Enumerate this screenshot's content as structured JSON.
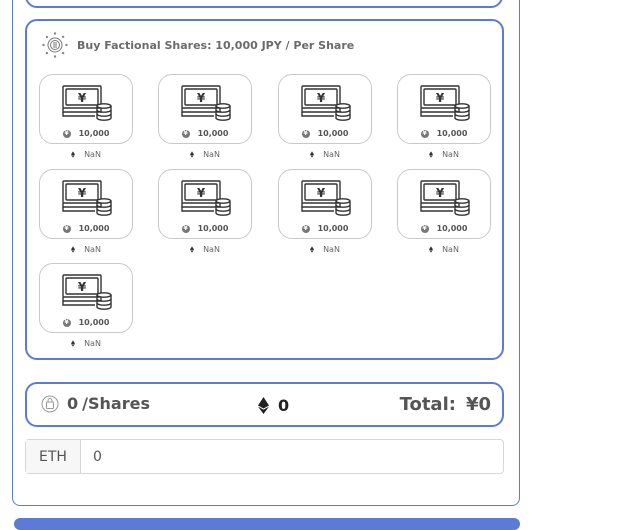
{
  "panel": {
    "title": "Buy Factional Shares: 10,000 JPY / Per Share"
  },
  "shares": [
    {
      "price": "10,000",
      "eth": "NaN"
    },
    {
      "price": "10,000",
      "eth": "NaN"
    },
    {
      "price": "10,000",
      "eth": "NaN"
    },
    {
      "price": "10,000",
      "eth": "NaN"
    },
    {
      "price": "10,000",
      "eth": "NaN"
    },
    {
      "price": "10,000",
      "eth": "NaN"
    },
    {
      "price": "10,000",
      "eth": "NaN"
    },
    {
      "price": "10,000",
      "eth": "NaN"
    },
    {
      "price": "10,000",
      "eth": "NaN"
    }
  ],
  "summary": {
    "shares_count": "0",
    "shares_unit": "/Shares",
    "eth_amount": "0",
    "total_label": "Total:",
    "total_value": "¥0"
  },
  "input": {
    "addon": "ETH",
    "value": "0"
  },
  "icons": {
    "coin": "coin-bill-icon",
    "bill": "yen-banknote-stack-icon",
    "ethereum": "ethereum-icon",
    "bag": "shopping-bag-icon"
  },
  "colors": {
    "accent": "#5b7bd5",
    "border": "#c9c9c9",
    "text": "#555555"
  }
}
